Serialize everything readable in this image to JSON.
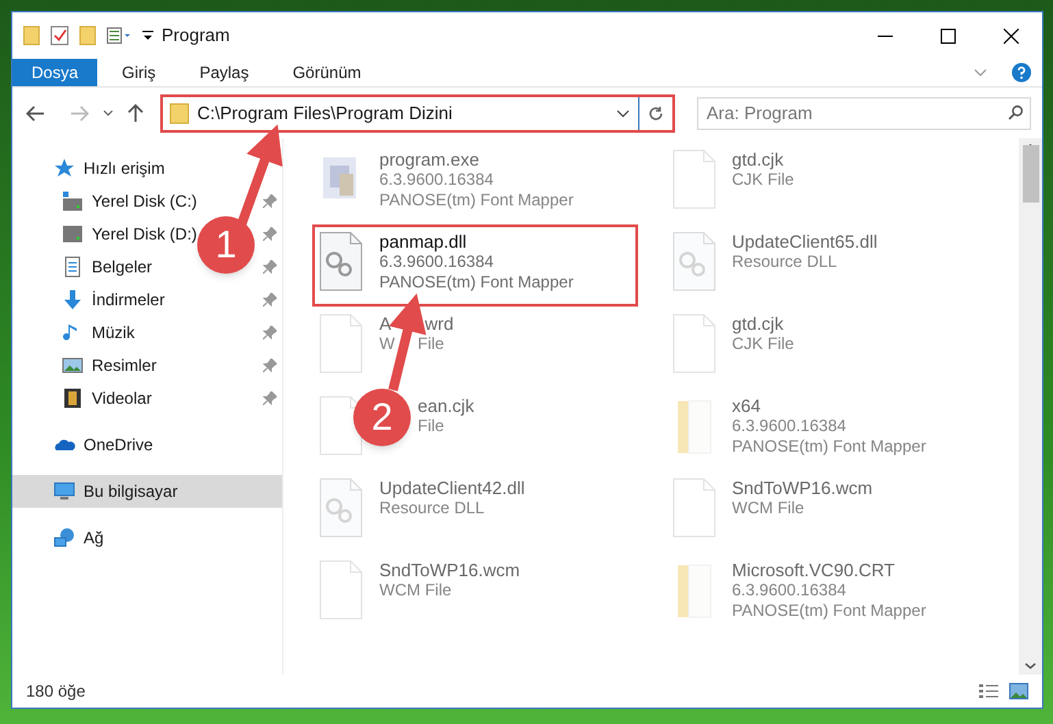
{
  "window": {
    "title": "Program"
  },
  "ribbon_tabs": [
    {
      "label": "Dosya",
      "kind": "file"
    },
    {
      "label": "Giriş",
      "kind": "tab"
    },
    {
      "label": "Paylaş",
      "kind": "tab"
    },
    {
      "label": "Görünüm",
      "kind": "tab"
    }
  ],
  "address_bar": {
    "path": "C:\\Program Files\\Program Dizini",
    "highlighted": true
  },
  "search": {
    "placeholder": "Ara: Program"
  },
  "sidebar": {
    "items": [
      {
        "label": "Hızlı erişim",
        "kind": "star",
        "selected": false,
        "children": [
          {
            "label": "Yerel Disk (C:)",
            "kind": "drive-c",
            "pinned": true
          },
          {
            "label": "Yerel Disk (D:)",
            "kind": "drive",
            "pinned": true
          },
          {
            "label": "Belgeler",
            "kind": "document",
            "pinned": true
          },
          {
            "label": "İndirmeler",
            "kind": "download",
            "pinned": true
          },
          {
            "label": "Müzik",
            "kind": "music",
            "pinned": true
          },
          {
            "label": "Resimler",
            "kind": "picture",
            "pinned": true
          },
          {
            "label": "Videolar",
            "kind": "video",
            "pinned": true
          }
        ]
      },
      {
        "label": "OneDrive",
        "kind": "cloud",
        "selected": false
      },
      {
        "label": "Bu bilgisayar",
        "kind": "computer",
        "selected": true
      },
      {
        "label": "Ağ",
        "kind": "network",
        "selected": false
      }
    ]
  },
  "files": [
    {
      "name": "program.exe",
      "details": [
        "6.3.9600.16384",
        "PANOSE(tm) Font Mapper"
      ],
      "kind": "app",
      "faded": true,
      "highlighted": false
    },
    {
      "name": "gtd.cjk",
      "details": [
        "CJK File"
      ],
      "kind": "file",
      "faded": true,
      "highlighted": false
    },
    {
      "name": "panmap.dll",
      "details": [
        "6.3.9600.16384",
        "PANOSE(tm) Font Mapper"
      ],
      "kind": "dll",
      "faded": false,
      "highlighted": true
    },
    {
      "name": "UpdateClient65.dll",
      "details": [
        "Resource DLL"
      ],
      "kind": "dll",
      "faded": true,
      "highlighted": false
    },
    {
      "name": "A       wrd",
      "details": [
        "W     File"
      ],
      "kind": "file",
      "faded": true,
      "highlighted": false
    },
    {
      "name": "gtd.cjk",
      "details": [
        "CJK File"
      ],
      "kind": "file",
      "faded": true,
      "highlighted": false
    },
    {
      "name": "ean.cjk",
      "details": [
        "File"
      ],
      "kind": "file",
      "faded": true,
      "highlighted": false,
      "obscured": true
    },
    {
      "name": "x64",
      "details": [
        "6.3.9600.16384",
        "PANOSE(tm) Font Mapper"
      ],
      "kind": "folder",
      "faded": true,
      "highlighted": false
    },
    {
      "name": "UpdateClient42.dll",
      "details": [
        "Resource DLL"
      ],
      "kind": "dll",
      "faded": true,
      "highlighted": false
    },
    {
      "name": "SndToWP16.wcm",
      "details": [
        "WCM File"
      ],
      "kind": "file",
      "faded": true,
      "highlighted": false
    },
    {
      "name": "SndToWP16.wcm",
      "details": [
        "WCM File"
      ],
      "kind": "file",
      "faded": true,
      "highlighted": false
    },
    {
      "name": "Microsoft.VC90.CRT",
      "details": [
        "6.3.9600.16384",
        "PANOSE(tm) Font Mapper"
      ],
      "kind": "folder",
      "faded": true,
      "highlighted": false
    }
  ],
  "callouts": [
    {
      "number": "1"
    },
    {
      "number": "2"
    }
  ],
  "status_bar": {
    "item_count": "180 öğe"
  }
}
